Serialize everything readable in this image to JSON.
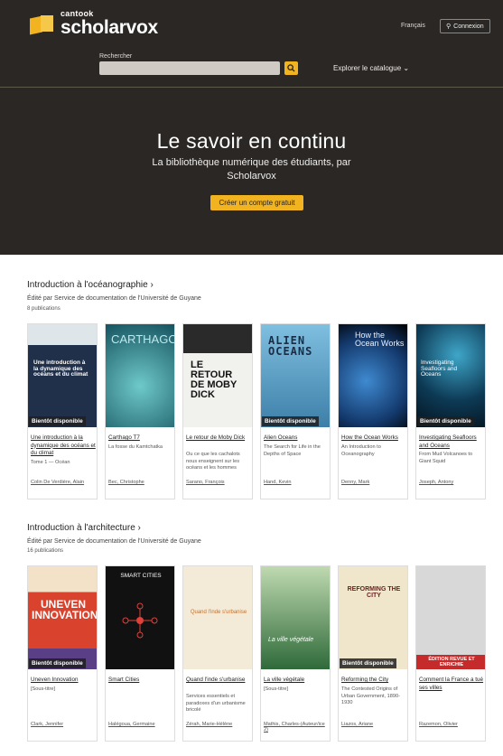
{
  "header": {
    "brand_small": "cantook",
    "brand_big": "scholarvox",
    "language": "Français",
    "login": "Connexion"
  },
  "search": {
    "label": "Rechercher",
    "placeholder": ""
  },
  "explore": "Explorer le catalogue",
  "hero": {
    "title": "Le savoir en continu",
    "subtitle": "La bibliothèque numérique des étudiants, par Scholarvox",
    "cta": "Créer un compte gratuit"
  },
  "sections": [
    {
      "title": "Introduction à l'océanographie",
      "editor": "Édité par Service de documentation de l'Université de Guyane",
      "count": "8 publications",
      "books": [
        {
          "title": "Une introduction à la dynamique des océans et du climat",
          "sub": "Tome 1 — Océan",
          "author": "Colin De Verdière, Alain",
          "badge": "Bientôt disponible",
          "cover_color": "#1f2a40",
          "cover_text": "Une introduction à la dynamique des océans et du climat"
        },
        {
          "title": "Carthago T7",
          "sub": "La fosse du Kamtchatka",
          "author": "Bec, Christophe",
          "badge": "",
          "cover_color": "#1c6f7a",
          "cover_text": "CARTHAGO"
        },
        {
          "title": "Le retour de Moby Dick",
          "sub": "Ou ce que les cachalots nous enseignent sur les océans et les hommes",
          "author": "Sarano, François",
          "badge": "",
          "cover_color": "#f1f1ee",
          "cover_text": "LE RETOUR DE MOBY DICK"
        },
        {
          "title": "Alien Oceans",
          "sub": "The Search for Life in the Depths of Space",
          "author": "Hand, Kevin",
          "badge": "Bientôt disponible",
          "cover_color": "#5aa2c9",
          "cover_text": "ALIEN OCEANS"
        },
        {
          "title": "How the Ocean Works",
          "sub": "An Introduction to Oceanography",
          "author": "Denny, Mark",
          "badge": "",
          "cover_color": "#143a6e",
          "cover_text": "How the Ocean Works"
        },
        {
          "title": "Investigating Seafloors and Oceans",
          "sub": "From Mud Volcanoes to Giant Squid",
          "author": "Joseph, Antony",
          "badge": "Bientôt disponible",
          "cover_color": "#0d3a55",
          "cover_text": "Investigating Seafloors and Oceans"
        }
      ]
    },
    {
      "title": "Introduction à l'architecture",
      "editor": "Édité par Service de documentation de l'Université de Guyane",
      "count": "16 publications",
      "books": [
        {
          "title": "Uneven Innovation",
          "sub": "[Sous-titre]",
          "author": "Clark, Jennifer",
          "badge": "Bientôt disponible",
          "cover_color": "#d9432e",
          "cover_text": "UNEVEN INNOVATION"
        },
        {
          "title": "Smart Cities",
          "sub": "",
          "author": "Halégoua, Germaine",
          "badge": "",
          "cover_color": "#111111",
          "cover_text": "SMART CITIES"
        },
        {
          "title": "Quand l'inde s'urbanise",
          "sub": "Services essentiels et paradoxes d'un urbanisme bricolé",
          "author": "Zérah, Marie-Hélène",
          "badge": "",
          "cover_color": "#f4ead8",
          "cover_text": "Quand l'inde s'urbanise"
        },
        {
          "title": "La ville végétale",
          "sub": "[Sous-titre]",
          "author": "Mathis, Charles-(Auteur/ice 2)",
          "badge": "",
          "cover_color": "#2f6a3a",
          "cover_text": "La ville végétale"
        },
        {
          "title": "Reforming the City",
          "sub": "The Contested Origins of Urban Government, 1890-1930",
          "author": "Liazos, Ariane",
          "badge": "Bientôt disponible",
          "cover_color": "#efe6cc",
          "cover_text": "REFORMING THE CITY"
        },
        {
          "title": "Comment la France a tué ses villes",
          "sub": "",
          "author": "Razemon, Olivier",
          "badge": "",
          "cover_color": "#c62b2b",
          "cover_text": "ÉDITION REVUE ET ENRICHIE"
        }
      ]
    }
  ]
}
